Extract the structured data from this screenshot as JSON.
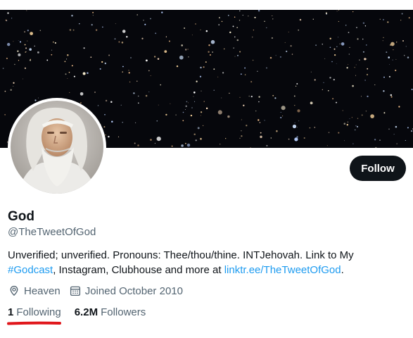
{
  "profile": {
    "name": "God",
    "handle": "@TheTweetOfGod",
    "bio_text": "Unverified; unverified. Pronouns: Thee/thou/thine. INTJehovah. Link to My ",
    "bio_hashtag": "#Godcast",
    "bio_mid": ", Instagram, Clubhouse and more at ",
    "bio_link": "linktr.ee/TheTweetOfGod",
    "bio_end": "."
  },
  "actions": {
    "follow_label": "Follow"
  },
  "meta": {
    "location": "Heaven",
    "joined": "Joined October 2010"
  },
  "stats": {
    "following_count": "1",
    "following_label": "Following",
    "followers_count": "6.2M",
    "followers_label": "Followers"
  },
  "colors": {
    "link": "#1d9bf0",
    "button_bg": "#0f1419",
    "secondary_text": "#536471",
    "annotation": "#e0161b"
  },
  "icons": {
    "location": "location-pin-icon",
    "joined": "calendar-icon"
  }
}
